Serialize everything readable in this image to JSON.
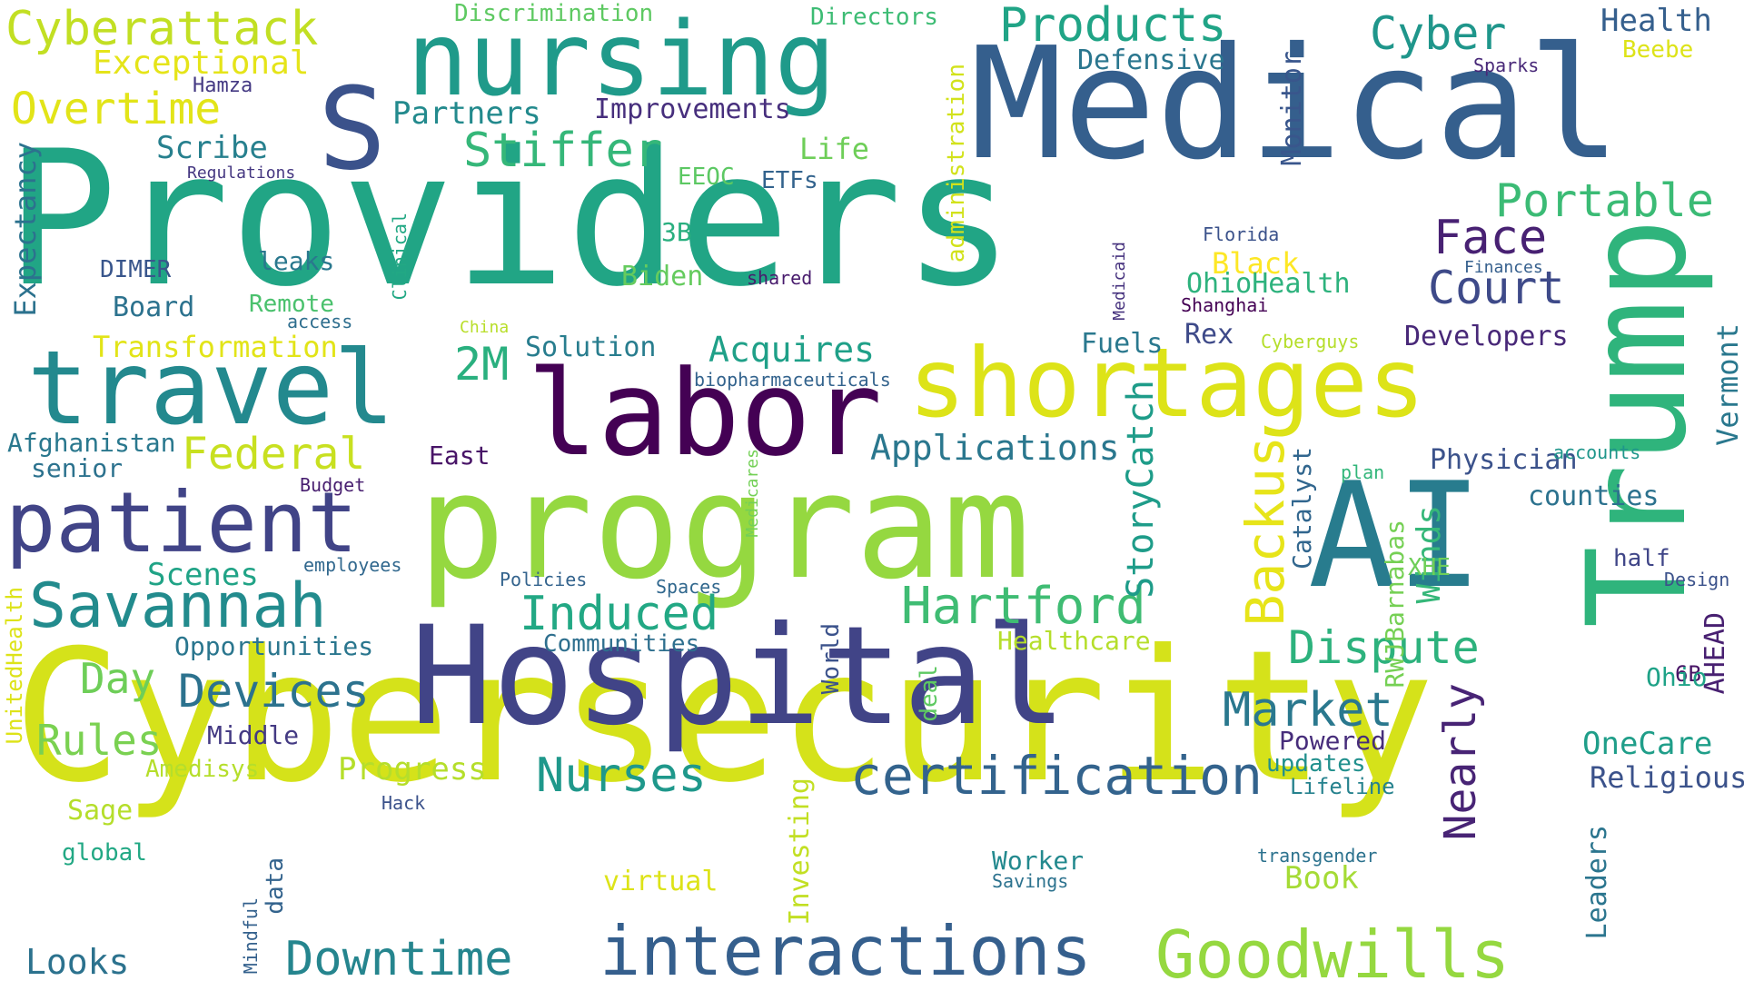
{
  "words": [
    {
      "text": "Providers",
      "color": "#21a585"
    },
    {
      "text": "Cybersecurity",
      "color": "#d5e21a"
    },
    {
      "text": "Hospital",
      "color": "#414487"
    },
    {
      "text": "Medical",
      "color": "#355f8d"
    },
    {
      "text": "program",
      "color": "#95d840"
    },
    {
      "text": "Trump",
      "color": "#2fb47c"
    },
    {
      "text": "nursing",
      "color": "#1f9a8a"
    },
    {
      "text": "labor",
      "color": "#440154"
    },
    {
      "text": "shortages",
      "color": "#dde318"
    },
    {
      "text": "travel",
      "color": "#23898e"
    },
    {
      "text": "AI",
      "color": "#287c8e"
    },
    {
      "text": "patient",
      "color": "#414487"
    },
    {
      "text": "S",
      "color": "#3b528b"
    },
    {
      "text": "interactions",
      "color": "#355f8d"
    },
    {
      "text": "Goodwills",
      "color": "#95d840"
    },
    {
      "text": "certification",
      "color": "#33638d"
    },
    {
      "text": "Savannah",
      "color": "#228b8d"
    },
    {
      "text": "Cyberattack",
      "color": "#c2df23"
    },
    {
      "text": "Hartford",
      "color": "#3fbc73"
    },
    {
      "text": "Dispute",
      "color": "#2db27d"
    },
    {
      "text": "Market",
      "color": "#2a788e"
    },
    {
      "text": "Downtime",
      "color": "#25858e"
    },
    {
      "text": "Backus",
      "color": "#e7e419"
    },
    {
      "text": "Nurses",
      "color": "#1f988b"
    },
    {
      "text": "Induced",
      "color": "#22a884"
    },
    {
      "text": "Portable",
      "color": "#3bbb75"
    },
    {
      "text": "Products",
      "color": "#20a486"
    },
    {
      "text": "Cyber",
      "color": "#1f968b"
    },
    {
      "text": "Stiffer",
      "color": "#35b779"
    },
    {
      "text": "Face",
      "color": "#482173"
    },
    {
      "text": "Court",
      "color": "#3e4a89"
    },
    {
      "text": "Devices",
      "color": "#2c728e"
    },
    {
      "text": "Overtime",
      "color": "#e2e418"
    },
    {
      "text": "Federal",
      "color": "#c8e020"
    },
    {
      "text": "Nearly",
      "color": "#482475"
    },
    {
      "text": "Rules",
      "color": "#7ad151"
    },
    {
      "text": "Day",
      "color": "#6ece58"
    },
    {
      "text": "StoryCatch",
      "color": "#1e9c89"
    },
    {
      "text": "Applications",
      "color": "#2a778e"
    },
    {
      "text": "Acquires",
      "color": "#1fa088"
    },
    {
      "text": "Partners",
      "color": "#238a8d"
    },
    {
      "text": "Exceptional",
      "color": "#e5e419"
    },
    {
      "text": "Improvements",
      "color": "#472f7d"
    },
    {
      "text": "Scribe",
      "color": "#27808e"
    },
    {
      "text": "Expectancy",
      "color": "#2c728e"
    },
    {
      "text": "Transformation",
      "color": "#e2e418"
    },
    {
      "text": "Monitor",
      "color": "#39568c"
    },
    {
      "text": "Defensive",
      "color": "#2a768e"
    },
    {
      "text": "Health",
      "color": "#355f8d"
    },
    {
      "text": "Beebe",
      "color": "#dde318"
    },
    {
      "text": "Directors",
      "color": "#3dbc74"
    },
    {
      "text": "Discrimination",
      "color": "#5ec962"
    },
    {
      "text": "Hamza",
      "color": "#443983"
    },
    {
      "text": "Regulations",
      "color": "#453781"
    },
    {
      "text": "EEOC",
      "color": "#5cc863"
    },
    {
      "text": "ETFs",
      "color": "#33638d"
    },
    {
      "text": "Life",
      "color": "#6ece58"
    },
    {
      "text": "3B",
      "color": "#29af7f"
    },
    {
      "text": "Biden",
      "color": "#65cb5e"
    },
    {
      "text": "shared",
      "color": "#481b6d"
    },
    {
      "text": "administration",
      "color": "#d2e21b"
    },
    {
      "text": "Clinical",
      "color": "#22a884"
    },
    {
      "text": "DIMER",
      "color": "#39568c"
    },
    {
      "text": "leaks",
      "color": "#2a788e"
    },
    {
      "text": "Board",
      "color": "#2c728e"
    },
    {
      "text": "Remote",
      "color": "#4ac16d"
    },
    {
      "text": "access",
      "color": "#2e6e8e"
    },
    {
      "text": "China",
      "color": "#b8de29"
    },
    {
      "text": "2M",
      "color": "#2ab07f"
    },
    {
      "text": "Solution",
      "color": "#287d8e"
    },
    {
      "text": "biopharmaceuticals",
      "color": "#33638d"
    },
    {
      "text": "Fuels",
      "color": "#2a788e"
    },
    {
      "text": "Rex",
      "color": "#3e4a89"
    },
    {
      "text": "Cyberguys",
      "color": "#b5de2b"
    },
    {
      "text": "Developers",
      "color": "#482878"
    },
    {
      "text": "Vermont",
      "color": "#2a788e"
    },
    {
      "text": "Black",
      "color": "#fde725"
    },
    {
      "text": "OhioHealth",
      "color": "#2db27d"
    },
    {
      "text": "Florida",
      "color": "#3b528b"
    },
    {
      "text": "Medicaid",
      "color": "#46327e"
    },
    {
      "text": "Shanghai",
      "color": "#440154"
    },
    {
      "text": "Finances",
      "color": "#355f8d"
    },
    {
      "text": "Sparks",
      "color": "#482878"
    },
    {
      "text": "Afghanistan",
      "color": "#2a788e"
    },
    {
      "text": "senior",
      "color": "#2c728e"
    },
    {
      "text": "Budget",
      "color": "#481f70"
    },
    {
      "text": "East",
      "color": "#481467"
    },
    {
      "text": "Physician",
      "color": "#3b528b"
    },
    {
      "text": "accounts",
      "color": "#1f968b"
    },
    {
      "text": "plan",
      "color": "#32b67a"
    },
    {
      "text": "counties",
      "color": "#2c728e"
    },
    {
      "text": "half",
      "color": "#404688"
    },
    {
      "text": "Design",
      "color": "#3b528b"
    },
    {
      "text": "Catalyst",
      "color": "#31668e"
    },
    {
      "text": "Medicares",
      "color": "#73d056"
    },
    {
      "text": "RWJBarnabas",
      "color": "#75d054"
    },
    {
      "text": "Winds",
      "color": "#35b779"
    },
    {
      "text": "XHE",
      "color": "#6ece58"
    },
    {
      "text": "AHEAD",
      "color": "#482071"
    },
    {
      "text": "Scenes",
      "color": "#20a386"
    },
    {
      "text": "employees",
      "color": "#31688e"
    },
    {
      "text": "Policies",
      "color": "#33638d"
    },
    {
      "text": "Spaces",
      "color": "#31688e"
    },
    {
      "text": "Communities",
      "color": "#2e6f8e"
    },
    {
      "text": "Opportunities",
      "color": "#2a768e"
    },
    {
      "text": "Healthcare",
      "color": "#b5de2b"
    },
    {
      "text": "6B",
      "color": "#471365"
    },
    {
      "text": "Ohio",
      "color": "#1fa287"
    },
    {
      "text": "World",
      "color": "#3b528b"
    },
    {
      "text": "deal",
      "color": "#5ec962"
    },
    {
      "text": "Middle",
      "color": "#443a83"
    },
    {
      "text": "UnitedHealth",
      "color": "#dde318"
    },
    {
      "text": "Amedisys",
      "color": "#b5de2b"
    },
    {
      "text": "Progress",
      "color": "#b5de2b"
    },
    {
      "text": "Powered",
      "color": "#472d7b"
    },
    {
      "text": "OneCare",
      "color": "#1f9e89"
    },
    {
      "text": "updates",
      "color": "#21908d"
    },
    {
      "text": "Lifeline",
      "color": "#26828e"
    },
    {
      "text": "Religious",
      "color": "#3b528b"
    },
    {
      "text": "Sage",
      "color": "#b5de2b"
    },
    {
      "text": "Hack",
      "color": "#3b528b"
    },
    {
      "text": "global",
      "color": "#22a884"
    },
    {
      "text": "Investing",
      "color": "#c2df23"
    },
    {
      "text": "transgender",
      "color": "#2c728e"
    },
    {
      "text": "Worker",
      "color": "#23898e"
    },
    {
      "text": "Savings",
      "color": "#2c728e"
    },
    {
      "text": "Book",
      "color": "#a5db36"
    },
    {
      "text": "Leaders",
      "color": "#2b758e"
    },
    {
      "text": "virtual",
      "color": "#dde318"
    },
    {
      "text": "data",
      "color": "#33638d"
    },
    {
      "text": "Mindful",
      "color": "#34618d"
    },
    {
      "text": "Looks",
      "color": "#2c728e"
    }
  ]
}
